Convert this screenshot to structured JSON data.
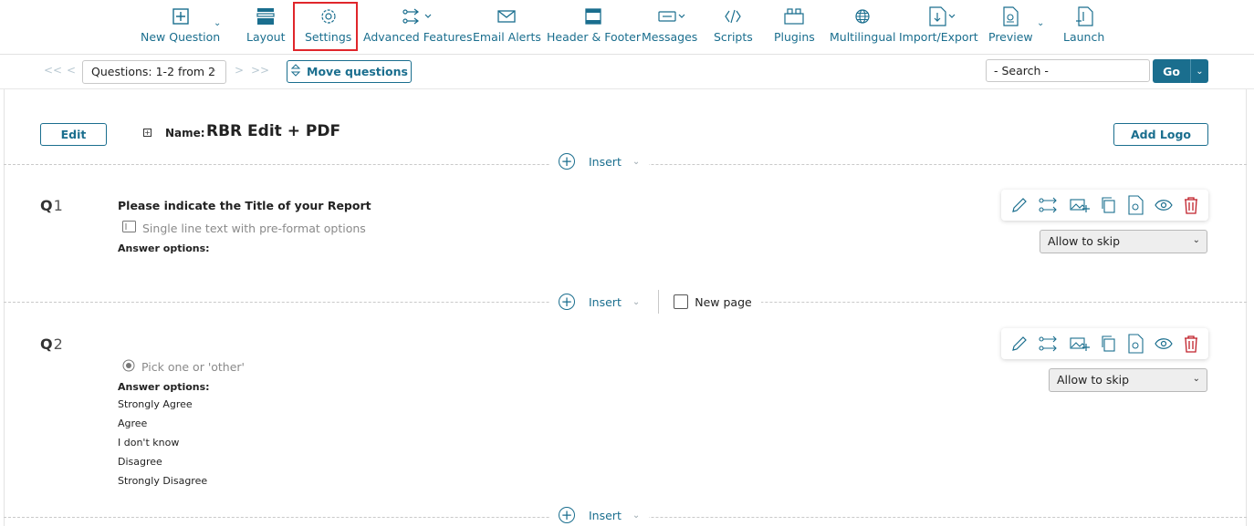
{
  "toolbar": {
    "items": [
      {
        "label": "New Question",
        "icon": "plus-square-icon"
      },
      {
        "label": "Layout",
        "icon": "layout-icon"
      },
      {
        "label": "Settings",
        "icon": "gear-icon"
      },
      {
        "label": "Advanced Features",
        "icon": "branch-icon"
      },
      {
        "label": "Email Alerts",
        "icon": "envelope-icon"
      },
      {
        "label": "Header & Footer",
        "icon": "header-footer-icon"
      },
      {
        "label": "Messages",
        "icon": "message-icon"
      },
      {
        "label": "Scripts",
        "icon": "code-icon"
      },
      {
        "label": "Plugins",
        "icon": "plugin-icon"
      },
      {
        "label": "Multilingual",
        "icon": "globe-icon"
      },
      {
        "label": "Import/Export",
        "icon": "import-export-icon"
      },
      {
        "label": "Preview",
        "icon": "preview-icon"
      },
      {
        "label": "Launch",
        "icon": "launch-icon"
      }
    ],
    "highlight_color": "#e0262b",
    "accent_color": "#1a6e8e"
  },
  "navbar": {
    "questions_select": "Questions: 1-2 from 2",
    "move_label": "Move questions",
    "search_placeholder": "- Search -",
    "go_label": "Go"
  },
  "survey": {
    "edit_label": "Edit",
    "name_label": "Name:",
    "name_value": "RBR Edit + PDF",
    "add_logo_label": "Add Logo",
    "insert_label": "Insert",
    "new_page_label": "New page"
  },
  "questions": [
    {
      "prefix": "Q",
      "number": "1",
      "title": "Please indicate the Title of your Report",
      "type": "Single line text with pre-format options",
      "answer_options_label": "Answer options:",
      "answers": [],
      "skip": "Allow to skip"
    },
    {
      "prefix": "Q",
      "number": "2",
      "title": "",
      "type": "Pick one or 'other'",
      "answer_options_label": "Answer options:",
      "answers": [
        "Strongly Agree",
        "Agree",
        "I don't know",
        "Disagree",
        "Strongly Disagree"
      ],
      "skip": "Allow to skip"
    }
  ]
}
